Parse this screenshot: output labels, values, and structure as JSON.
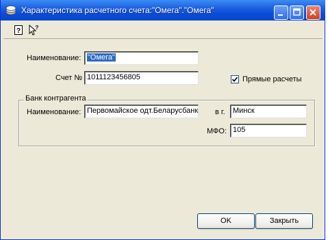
{
  "window": {
    "title": "Характеристика расчетного счета:\"Омега\".\"Омега\""
  },
  "account": {
    "name_label": "Наименование:",
    "name_value": "\"Омега\"",
    "number_label": "Счет №",
    "number_value": "1011123456805",
    "direct_label": "Прямые расчеты",
    "direct_checked": true
  },
  "bank": {
    "group_label": "Банк контрагента",
    "name_label": "Наименование:",
    "name_value": "Первомайское одт.Беларусбанк",
    "city_label": "в г.",
    "city_value": "Минск",
    "mfo_label": "МФО:",
    "mfo_value": "105"
  },
  "buttons": {
    "ok": "OK",
    "close": "Закрыть"
  },
  "icons": {
    "app": "bank-app-icon",
    "help": "question-help-icon",
    "whats_this": "pointer-help-icon"
  }
}
